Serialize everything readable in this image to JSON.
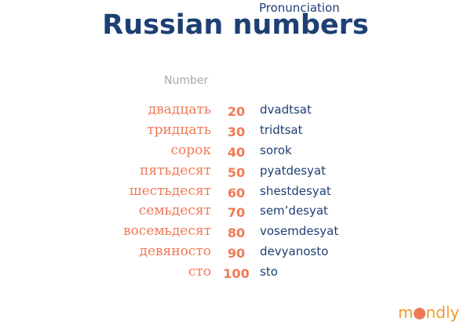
{
  "title": "Russian numbers",
  "headers": {
    "number": "Number",
    "pronunciation": "Pronunciation"
  },
  "rows": [
    {
      "russian": "двадцать",
      "number": "20",
      "pronunciation": "dvadtsat"
    },
    {
      "russian": "тридцать",
      "number": "30",
      "pronunciation": "tridtsat"
    },
    {
      "russian": "сорок",
      "number": "40",
      "pronunciation": "sorok"
    },
    {
      "russian": "пятьдесят",
      "number": "50",
      "pronunciation": "pyatdesyat"
    },
    {
      "russian": "шестьдесят",
      "number": "60",
      "pronunciation": "shestdesyat"
    },
    {
      "russian": "семьдесят",
      "number": "70",
      "pronunciation": "sem’desyat"
    },
    {
      "russian": "восемьдесят",
      "number": "80",
      "pronunciation": "vosemdesyat"
    },
    {
      "russian": "девяносто",
      "number": "90",
      "pronunciation": "devyanosto"
    },
    {
      "russian": "сто",
      "number": "100",
      "pronunciation": "sto"
    }
  ],
  "logo": {
    "text_before": "m",
    "icon": "globe-icon",
    "text_after": "ndly"
  },
  "colors": {
    "title": "#1d3f73",
    "accent": "#f07a56",
    "header": "#a8a8a8",
    "logo": "#f29a2e"
  }
}
